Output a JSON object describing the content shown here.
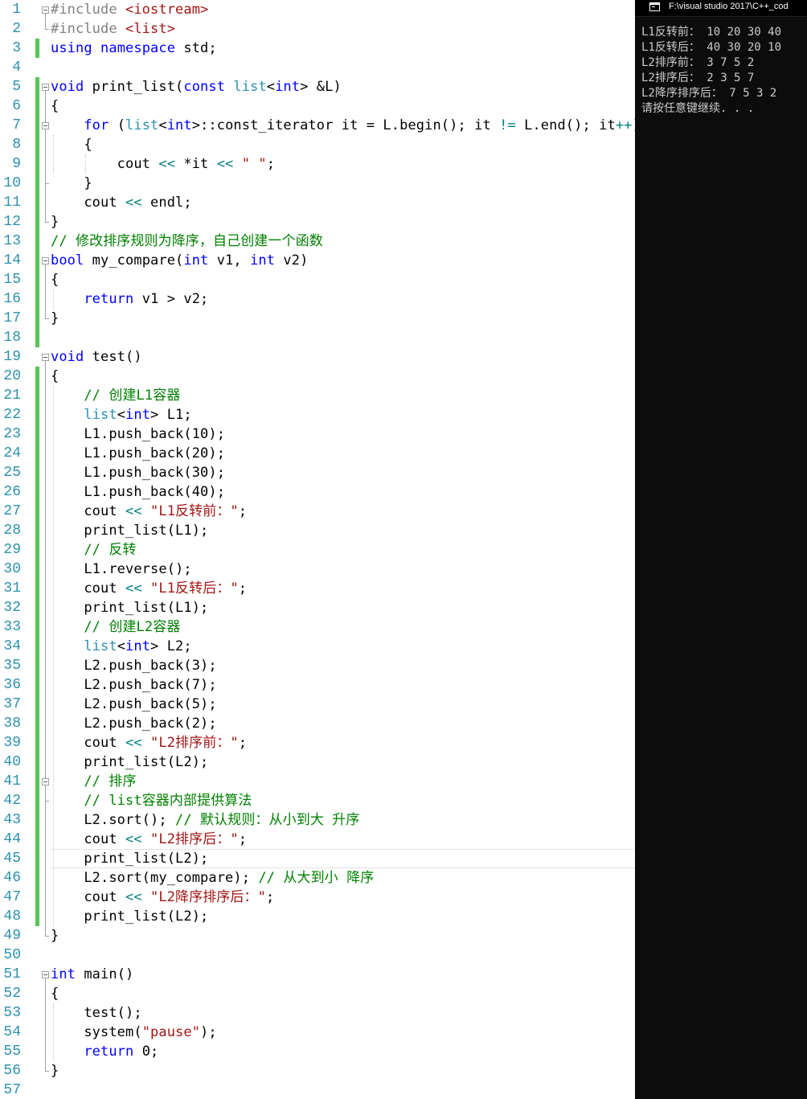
{
  "editor": {
    "lines": [
      "#include <iostream>",
      "#include <list>",
      "using namespace std;",
      "",
      "void print_list(const list<int> &L)",
      "{",
      "    for (list<int>::const_iterator it = L.begin(); it != L.end(); it++)",
      "    {",
      "        cout << *it << \" \";",
      "    }",
      "    cout << endl;",
      "}",
      "// 修改排序规则为降序，自己创建一个函数",
      "bool my_compare(int v1, int v2)",
      "{",
      "    return v1 > v2;",
      "}",
      "",
      "void test()",
      "{",
      "    // 创建L1容器",
      "    list<int> L1;",
      "    L1.push_back(10);",
      "    L1.push_back(20);",
      "    L1.push_back(30);",
      "    L1.push_back(40);",
      "    cout << \"L1反转前：\";",
      "    print_list(L1);",
      "    // 反转",
      "    L1.reverse();",
      "    cout << \"L1反转后：\";",
      "    print_list(L1);",
      "    // 创建L2容器",
      "    list<int> L2;",
      "    L2.push_back(3);",
      "    L2.push_back(7);",
      "    L2.push_back(5);",
      "    L2.push_back(2);",
      "    cout << \"L2排序前：\";",
      "    print_list(L2);",
      "    // 排序",
      "    // list容器内部提供算法",
      "    L2.sort(); // 默认规则：从小到大 升序",
      "    cout << \"L2排序后：\";",
      "    print_list(L2);",
      "    L2.sort(my_compare); // 从大到小 降序",
      "    cout << \"L2降序排序后：\";",
      "    print_list(L2);",
      "}",
      "",
      "int main()",
      "{",
      "    test();",
      "    system(\"pause\");",
      "    return 0;",
      "}",
      ""
    ],
    "current_line": 45,
    "colors": {
      "keyword": "#0000ff",
      "preprocessor": "#808080",
      "type": "#2b91af",
      "string": "#a31515",
      "comment": "#008000",
      "operator": "#008080",
      "line_number": "#2b91af",
      "change_marker": "#57c558"
    }
  },
  "console": {
    "title": "F:\\visual studio 2017\\C++_cod",
    "icon": "console-window-icon",
    "output": [
      "L1反转前： 10 20 30 40",
      "L1反转后： 40 30 20 10",
      "L2排序前： 3 7 5 2",
      "L2排序后： 2 3 5 7",
      "L2降序排序后： 7 5 3 2",
      "请按任意键继续. . ."
    ]
  }
}
